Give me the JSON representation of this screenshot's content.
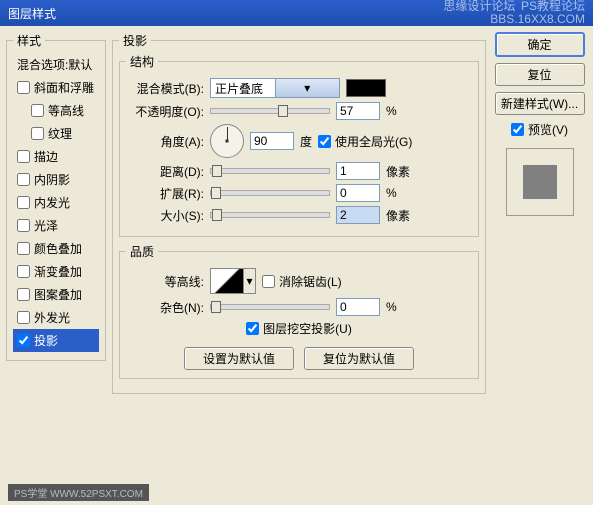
{
  "title": "图层样式",
  "watermark_top1": "思缘设计论坛",
  "watermark_top2": "PS教程论坛",
  "watermark_top3": "BBS.16XX8.COM",
  "left": {
    "header": "样式",
    "blend": "混合选项:默认",
    "items": [
      {
        "label": "斜面和浮雕",
        "checked": false
      },
      {
        "label": "等高线",
        "checked": false,
        "indent": true
      },
      {
        "label": "纹理",
        "checked": false,
        "indent": true
      },
      {
        "label": "描边",
        "checked": false
      },
      {
        "label": "内阴影",
        "checked": false
      },
      {
        "label": "内发光",
        "checked": false
      },
      {
        "label": "光泽",
        "checked": false
      },
      {
        "label": "颜色叠加",
        "checked": false
      },
      {
        "label": "渐变叠加",
        "checked": false
      },
      {
        "label": "图案叠加",
        "checked": false
      },
      {
        "label": "外发光",
        "checked": false
      },
      {
        "label": "投影",
        "checked": true,
        "selected": true
      }
    ]
  },
  "main": {
    "section": "投影",
    "group1": "结构",
    "blend_mode_lbl": "混合模式(B):",
    "blend_mode_val": "正片叠底",
    "opacity_lbl": "不透明度(O):",
    "opacity_val": "57",
    "pct": "%",
    "angle_lbl": "角度(A):",
    "angle_val": "90",
    "angle_unit": "度",
    "global_light": "使用全局光(G)",
    "distance_lbl": "距离(D):",
    "distance_val": "1",
    "px": "像素",
    "spread_lbl": "扩展(R):",
    "spread_val": "0",
    "size_lbl": "大小(S):",
    "size_val": "2",
    "group2": "品质",
    "contour_lbl": "等高线:",
    "antialias": "消除锯齿(L)",
    "noise_lbl": "杂色(N):",
    "noise_val": "0",
    "knockout": "图层挖空投影(U)",
    "btn_default": "设置为默认值",
    "btn_reset": "复位为默认值"
  },
  "right": {
    "ok": "确定",
    "reset": "复位",
    "newstyle": "新建样式(W)...",
    "preview": "预览(V)"
  },
  "bottom_wm": "PS学堂  WWW.52PSXT.COM"
}
